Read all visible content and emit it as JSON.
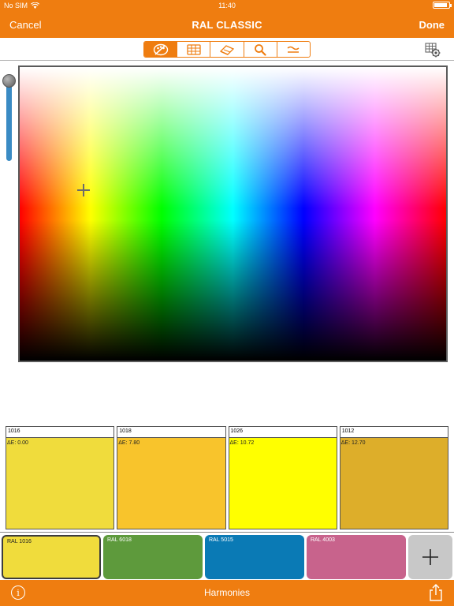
{
  "status_bar": {
    "carrier": "No SIM",
    "time": "11:40",
    "battery_level": 0.9
  },
  "nav": {
    "cancel_label": "Cancel",
    "title": "RAL CLASSIC",
    "done_label": "Done"
  },
  "toolbar": {
    "segments": [
      {
        "icon": "palette-icon",
        "active": true
      },
      {
        "icon": "color-fan-icon",
        "active": false
      },
      {
        "icon": "eraser-icon",
        "active": false
      },
      {
        "icon": "search-icon",
        "active": false
      },
      {
        "icon": "approx-equal-icon",
        "active": false
      }
    ],
    "settings_icon": "settings-gear-icon"
  },
  "picker": {
    "brightness": 1.0,
    "selected_hue_fraction": 0.15,
    "selected_lightness_fraction": 0.42
  },
  "results": [
    {
      "code": "1016",
      "delta": "ΔE: 0.00",
      "color": "#f0dc3c"
    },
    {
      "code": "1018",
      "delta": "ΔE: 7.80",
      "color": "#f8c42c"
    },
    {
      "code": "1026",
      "delta": "ΔE: 10.72",
      "color": "#ffff00"
    },
    {
      "code": "1012",
      "delta": "ΔE: 12.70",
      "color": "#ddae2a"
    }
  ],
  "favorites": [
    {
      "label": "RAL 1016",
      "color": "#f0dc3c",
      "selected": true
    },
    {
      "label": "RAL 6018",
      "color": "#5e9a3c",
      "selected": false
    },
    {
      "label": "RAL 5015",
      "color": "#0a7ab5",
      "selected": false
    },
    {
      "label": "RAL 4003",
      "color": "#c8638c",
      "selected": false
    }
  ],
  "bottom_bar": {
    "label": "Harmonies",
    "info_icon": "info-icon",
    "share_icon": "share-icon"
  },
  "theme": {
    "accent": "#ef7d10"
  }
}
